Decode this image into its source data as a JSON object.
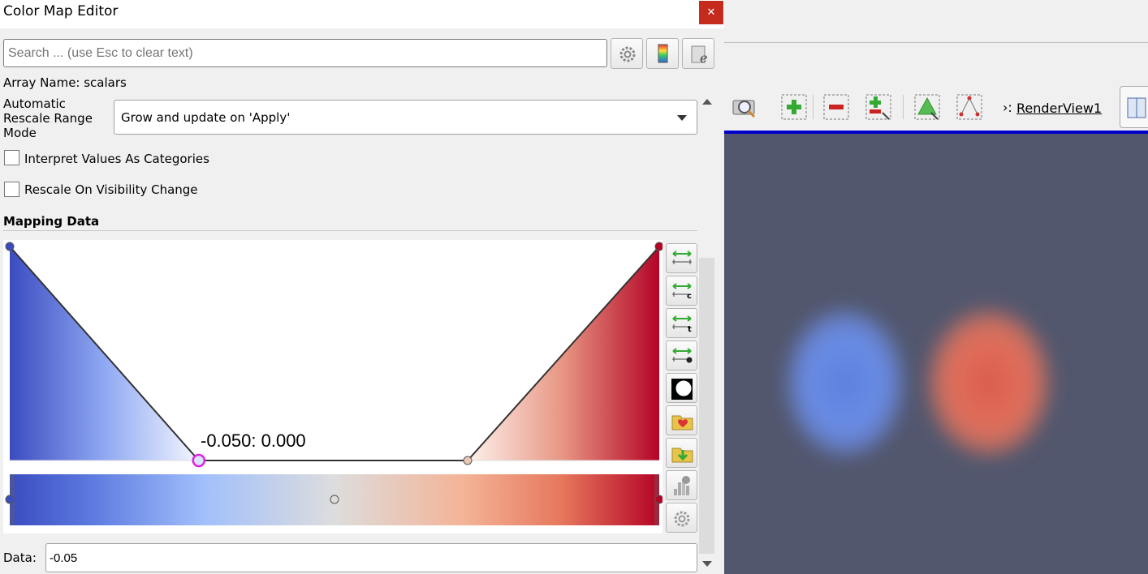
{
  "window": {
    "title": "Color Map Editor",
    "close_label": "✕"
  },
  "search": {
    "placeholder": "Search ... (use Esc to clear text)"
  },
  "array_name": "Array Name: scalars",
  "rescale": {
    "label": "Automatic Rescale Range Mode",
    "value": "Grow and update on 'Apply'"
  },
  "checkboxes": [
    {
      "label": "Interpret Values As Categories",
      "checked": false
    },
    {
      "label": "Rescale On Visibility Change",
      "checked": false
    }
  ],
  "mapping_data": {
    "heading": "Mapping Data",
    "tooltip": "-0.050: 0.000",
    "opacity_points": [
      {
        "x": 0.0,
        "y": 1.0,
        "color": "#3b4cc0"
      },
      {
        "x": 0.291,
        "y": 0.0,
        "color": "#ffffff",
        "selected": true
      },
      {
        "x": 0.705,
        "y": 0.0,
        "color": "#e8c6b4"
      },
      {
        "x": 1.0,
        "y": 1.0,
        "color": "#b40426"
      }
    ],
    "color_points": [
      {
        "x": 0.0,
        "color": "#3b4cc0"
      },
      {
        "x": 0.5,
        "color": "#dddddd"
      },
      {
        "x": 1.0,
        "color": "#b40426"
      }
    ],
    "colors": {
      "cool": "#3b4cc0",
      "mid": "#dddddd",
      "warm": "#b40426",
      "selection": "#e020e0"
    }
  },
  "side_tools": [
    {
      "name": "rescale-to-data-range-icon"
    },
    {
      "name": "rescale-to-custom-range-icon"
    },
    {
      "name": "rescale-to-data-range-over-time-icon"
    },
    {
      "name": "rescale-to-visible-range-icon"
    },
    {
      "name": "invert-transfer-function-icon"
    },
    {
      "name": "choose-preset-icon"
    },
    {
      "name": "save-to-preset-icon"
    },
    {
      "name": "compute-histogram-icon"
    },
    {
      "name": "advanced-settings-icon"
    }
  ],
  "data_field": {
    "label": "Data:",
    "value": "-0.05"
  },
  "render_view": {
    "label": "RenderView1",
    "toolbar": [
      "camera-zoom-icon",
      "add-point-icon",
      "remove-point-icon",
      "zoom-to-box-icon",
      "select-surface-icon",
      "select-points-icon"
    ],
    "background": "#52576e",
    "blobs": [
      {
        "color": "#6a8de6"
      },
      {
        "color": "#e2705c"
      }
    ]
  }
}
